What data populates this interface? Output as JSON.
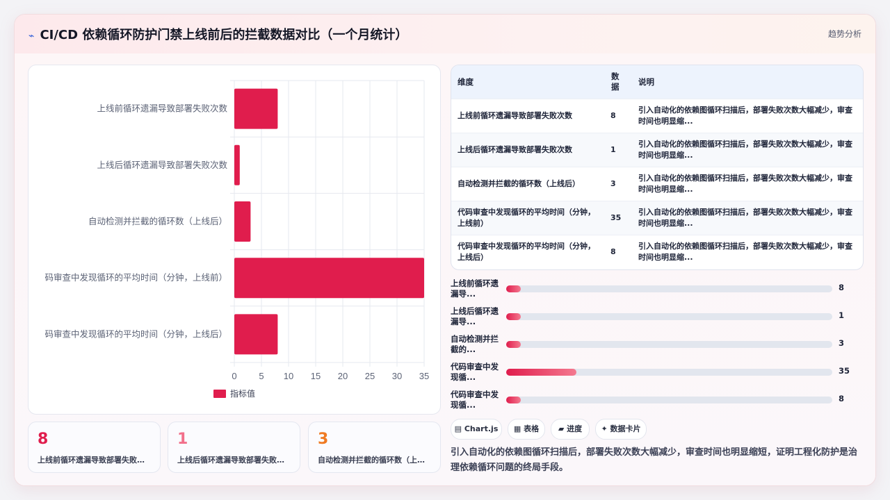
{
  "header": {
    "icon": "line-chart-icon",
    "title": "CI/CD 依赖循环防护门禁上线前后的拦截数据对比（一个月统计）",
    "trend_label": "趋势分析"
  },
  "chart_data": {
    "type": "bar",
    "orientation": "horizontal",
    "categories": [
      "上线前循环遗漏导致部署失败次数",
      "上线后循环遗漏导致部署失败次数",
      "自动检测并拦截的循环数（上线后）",
      "码审查中发现循环的平均时间（分钟，上线前）",
      "码审查中发现循环的平均时间（分钟，上线后）"
    ],
    "series": [
      {
        "name": "指标值",
        "values": [
          8,
          1,
          3,
          35,
          8
        ],
        "color": "#e01d4d"
      }
    ],
    "xlim": [
      0,
      35
    ],
    "xticks": [
      "0",
      "5",
      "10",
      "15",
      "20",
      "25",
      "30",
      "35"
    ],
    "grid": true,
    "legend": "bottom"
  },
  "table": {
    "headers": [
      "维度",
      "数据",
      "说明"
    ],
    "rows": [
      {
        "dim": "上线前循环遗漏导致部署失败次数",
        "val": "8",
        "desc": "引入自动化的依赖图循环扫描后，部署失败次数大幅减少，审查时间也明显缩..."
      },
      {
        "dim": "上线后循环遗漏导致部署失败次数",
        "val": "1",
        "desc": "引入自动化的依赖图循环扫描后，部署失败次数大幅减少，审查时间也明显缩..."
      },
      {
        "dim": "自动检测并拦截的循环数（上线后）",
        "val": "3",
        "desc": "引入自动化的依赖图循环扫描后，部署失败次数大幅减少，审查时间也明显缩..."
      },
      {
        "dim": "代码审查中发现循环的平均时间（分钟，上线前）",
        "val": "35",
        "desc": "引入自动化的依赖图循环扫描后，部署失败次数大幅减少，审查时间也明显缩..."
      },
      {
        "dim": "代码审查中发现循环的平均时间（分钟，上线后）",
        "val": "8",
        "desc": "引入自动化的依赖图循环扫描后，部署失败次数大幅减少，审查时间也明显缩..."
      }
    ]
  },
  "progress": [
    {
      "label": "上线前循环遗漏导...",
      "value": 8,
      "fraction": 0.0457
    },
    {
      "label": "上线后循环遗漏导...",
      "value": 1,
      "fraction": 0.0457
    },
    {
      "label": "自动检测并拦截的...",
      "value": 3,
      "fraction": 0.0457
    },
    {
      "label": "代码审查中发现循...",
      "value": 35,
      "fraction": 0.2164
    },
    {
      "label": "代码审查中发现循...",
      "value": 8,
      "fraction": 0.0457
    }
  ],
  "stats": [
    {
      "num": "8",
      "label": "上线前循环遗漏导致部署失败次数",
      "color": "#e01d4d"
    },
    {
      "num": "1",
      "label": "上线后循环遗漏导致部署失败次数",
      "color": "#f2708b"
    },
    {
      "num": "3",
      "label": "自动检测并拦截的循环数（上线后）",
      "color": "#ef7a22"
    }
  ],
  "chips": [
    {
      "icon": "grid-icon",
      "label": "Chart.js"
    },
    {
      "icon": "table-icon",
      "label": "表格"
    },
    {
      "icon": "progress-icon",
      "label": "进度"
    },
    {
      "icon": "sparkle-icon",
      "label": "数据卡片"
    }
  ],
  "summary": "引入自动化的依赖图循环扫描后，部署失败次数大幅减少，审查时间也明显缩短，证明工程化防护是治理依赖循环问题的终局手段。"
}
